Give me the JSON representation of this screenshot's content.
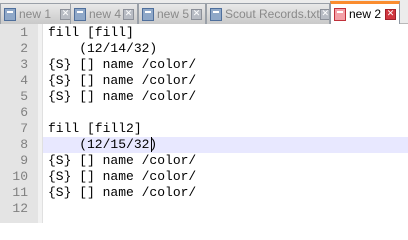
{
  "tabs": [
    {
      "label": "new 1",
      "active": false
    },
    {
      "label": "new 4",
      "active": false
    },
    {
      "label": "new 5",
      "active": false
    },
    {
      "label": "Scout Records.txt",
      "active": false
    },
    {
      "label": "new 2",
      "active": true
    }
  ],
  "colors": {
    "active_tab_accent": "#fa8c2f",
    "current_line_highlight": "#e8e8ff",
    "line_number": "#808080"
  },
  "editor": {
    "current_line": 8,
    "lines": [
      {
        "n": "1",
        "text": "fill [fill]"
      },
      {
        "n": "2",
        "text": "    (12/14/32)"
      },
      {
        "n": "3",
        "text": "{S} [] name /color/"
      },
      {
        "n": "4",
        "text": "{S} [] name /color/"
      },
      {
        "n": "5",
        "text": "{S} [] name /color/"
      },
      {
        "n": "6",
        "text": ""
      },
      {
        "n": "7",
        "text": "fill [fill2]"
      },
      {
        "n": "8",
        "text": "    (12/15/32)"
      },
      {
        "n": "9",
        "text": "{S} [] name /color/"
      },
      {
        "n": "10",
        "text": "{S} [] name /color/"
      },
      {
        "n": "11",
        "text": "{S} [] name /color/"
      },
      {
        "n": "12",
        "text": ""
      }
    ]
  }
}
